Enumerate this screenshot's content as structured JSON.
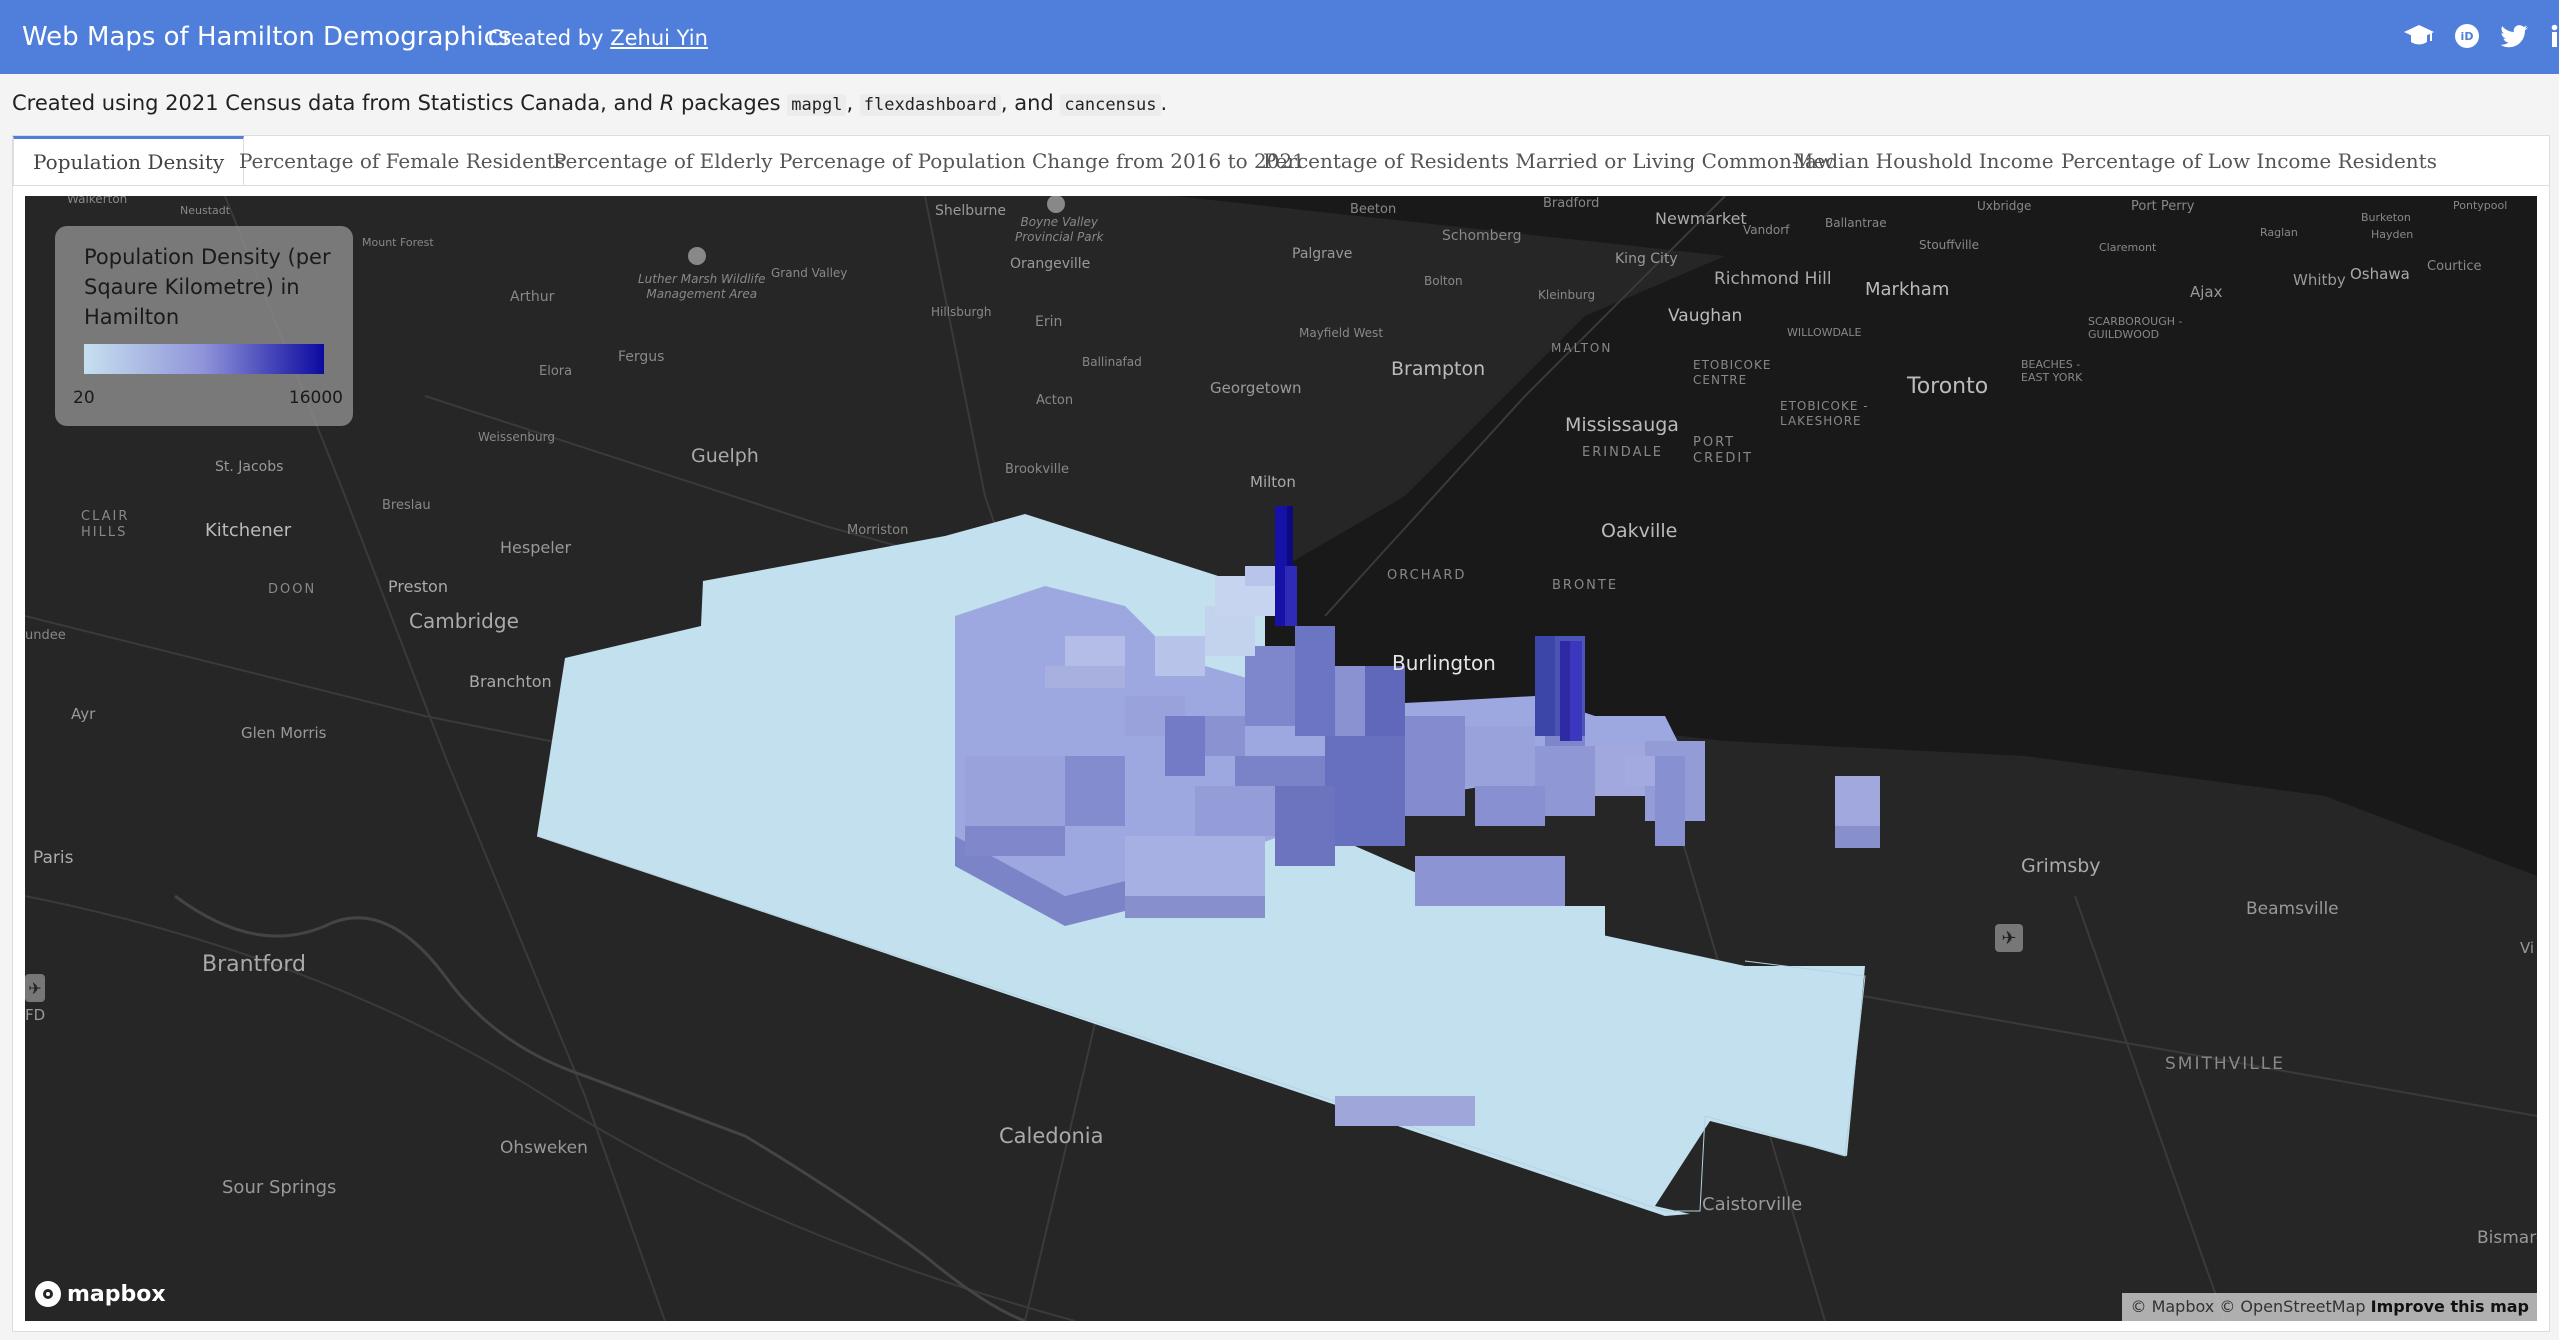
{
  "navbar": {
    "title": "Web Maps of Hamilton Demographics",
    "author_prefix": "Created by ",
    "author_name": "Zehui Yin",
    "icons": [
      "graduation-cap-icon",
      "researchgate-icon",
      "twitter-icon",
      "linkedin-icon"
    ],
    "icon_glyphs": {
      "cap": "🎓",
      "rg": "iD",
      "tw": "🐦",
      "in": "in"
    },
    "bg_color": "#4f7fdb"
  },
  "description": {
    "text1": "Created using 2021 Census data from Statistics Canada, and ",
    "r_letter": "R",
    "text2": " packages ",
    "pkg1": "mapgl",
    "sep1": ", ",
    "pkg2": "flexdashboard",
    "sep2": ", and ",
    "pkg3": "cancensus",
    "end": "."
  },
  "tabs": [
    {
      "label": "Population Density",
      "active": true
    },
    {
      "label": "Percentage of Female Residents",
      "active": false
    },
    {
      "label": "Percentage of Elderly",
      "active": false
    },
    {
      "label": "Percenage of Population Change from 2016 to 2021",
      "active": false
    },
    {
      "label": "Percentage of Residents Married or Living Common-law",
      "active": false
    },
    {
      "label": "Median Houshold Income",
      "active": false
    },
    {
      "label": "Percentage of Low Income Residents",
      "active": false
    }
  ],
  "legend": {
    "title": "Population Density (per Sqaure Kilometre) in Hamilton",
    "min": "20",
    "max": "16000",
    "color_low": "#c6e0ef",
    "color_high": "#0c0aa0"
  },
  "map_labels": {
    "toronto": "Toronto",
    "mississauga": "Mississauga",
    "brampton": "Brampton",
    "oakville": "Oakville",
    "burlington": "Burlington",
    "milton": "Milton",
    "kitchener": "Kitchener",
    "cambridge": "Cambridge",
    "guelph": "Guelph",
    "brantford": "Brantford",
    "caledonia": "Caledonia",
    "grimsby": "Grimsby",
    "beamsville": "Beamsville",
    "smithville": "SMITHVILLE",
    "caistorville": "Caistorville",
    "ohsweken": "Ohsweken",
    "sour_springs": "Sour Springs",
    "paris": "Paris",
    "glen_morris": "Glen Morris",
    "ayr": "Ayr",
    "branchton": "Branchton",
    "preston": "Preston",
    "hespeler": "Hespeler",
    "doon": "DOON",
    "morriston": "Morriston",
    "brookville": "Brookville",
    "acton": "Acton",
    "georgetown": "Georgetown",
    "markham": "Markham",
    "richmond_hill": "Richmond Hill",
    "vaughan": "Vaughan",
    "ajax": "Ajax",
    "whitby": "Whitby",
    "oshawa": "Oshawa",
    "newmarket": "Newmarket",
    "erin": "Erin",
    "orangeville": "Orangeville",
    "arthur": "Arthur",
    "fergus": "Fergus",
    "elora": "Elora",
    "st_jacobs": "St. Jacobs",
    "breslau": "Breslau",
    "clair_hills": "CLAIR\nHILLS",
    "orchard": "ORCHARD",
    "bronte": "BRONTE",
    "erindale": "ERINDALE",
    "port_credit": "PORT\nCREDIT",
    "etobicoke_centre": "ETOBICOKE\nCENTRE",
    "etobicoke_lakeshore": "ETOBICOKE -\nLAKESHORE",
    "malton": "MALTON",
    "bismarck": "Bismarc",
    "palgrave": "Palgrave",
    "king_city": "King City",
    "schomberg": "Schomberg",
    "shelburne": "Shelburne",
    "grand_valley": "Grand Valley",
    "luther": "Luther Marsh Wildlife\nManagement Area",
    "boyne": "Boyne Valley\nProvincial Park",
    "mayfield": "Mayfield West",
    "weissenburg": "Weissenburg",
    "dundee": "undee",
    "fd": "FD",
    "vi": "Vi",
    "scarborough": "SCARBOROUGH -\nGUILDWOOD",
    "beaches": "BEACHES -\nEAST YORK",
    "willowdale": "WILLOWDALE",
    "courtice": "Courtice",
    "port_perry": "Port Perry",
    "uxbridge": "Uxbridge",
    "stouffville": "Stouffville",
    "ballantrae": "Ballantrae",
    "vandorf": "Vandorf",
    "bradford": "Bradford",
    "beeton": "Beeton",
    "kleinburg": "Kleinburg",
    "bolton": "Bolton",
    "ballinafad": "Ballinafad",
    "hillsburgh": "Hillsburgh",
    "neustadt": "Neustadt",
    "mount_forest": "Mount Forest",
    "walkerton": "Walkerton",
    "claremont": "Claremont",
    "raglan": "Raglan",
    "hayden": "Hayden",
    "burketon": "Burketon",
    "pontypool": "Pontypool"
  },
  "mapbox_logo": "mapbox",
  "attribution": {
    "text": "© Mapbox © OpenStreetMap ",
    "improve": "Improve this map"
  }
}
